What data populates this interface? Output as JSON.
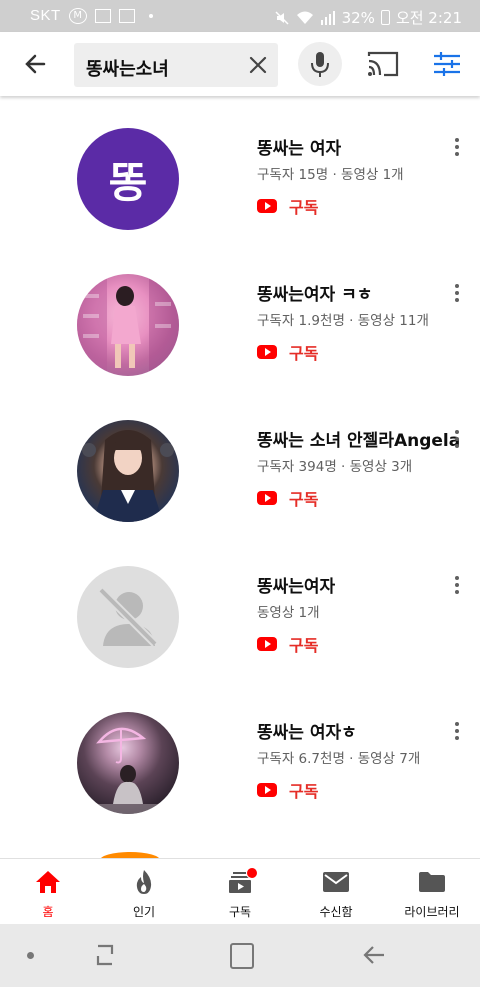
{
  "status_bar": {
    "carrier": "SKT",
    "battery": "32%",
    "time": "오전 2:21"
  },
  "search": {
    "query": "똥싸는소녀"
  },
  "results": [
    {
      "avatar_letter": "똥",
      "title": "똥싸는 여자",
      "meta": "구독자 15명 · 동영상 1개",
      "subscribe": "구독"
    },
    {
      "title": "똥싸는여자 ㅋㅎ",
      "meta": "구독자 1.9천명 · 동영상 11개",
      "subscribe": "구독"
    },
    {
      "title": "똥싸는 소녀 안젤라Angela",
      "meta": "구독자 394명 · 동영상 3개",
      "subscribe": "구독"
    },
    {
      "title": "똥싸는여자",
      "meta": "동영상 1개",
      "subscribe": "구독"
    },
    {
      "title": "똥싸는 여자ㅎ",
      "meta": "구독자 6.7천명 · 동영상 7개",
      "subscribe": "구독"
    }
  ],
  "bottom_nav": {
    "items": [
      {
        "label": "홈",
        "icon": "home-icon"
      },
      {
        "label": "인기",
        "icon": "trending-flame-icon"
      },
      {
        "label": "구독",
        "icon": "subscriptions-icon"
      },
      {
        "label": "수신함",
        "icon": "inbox-mail-icon"
      },
      {
        "label": "라이브러리",
        "icon": "library-folder-icon"
      }
    ]
  },
  "colors": {
    "accent_red": "#ff0000",
    "subscribe_red": "#e52d27",
    "avatar_purple": "#5b2ba6",
    "filter_blue": "#1a73e8"
  }
}
